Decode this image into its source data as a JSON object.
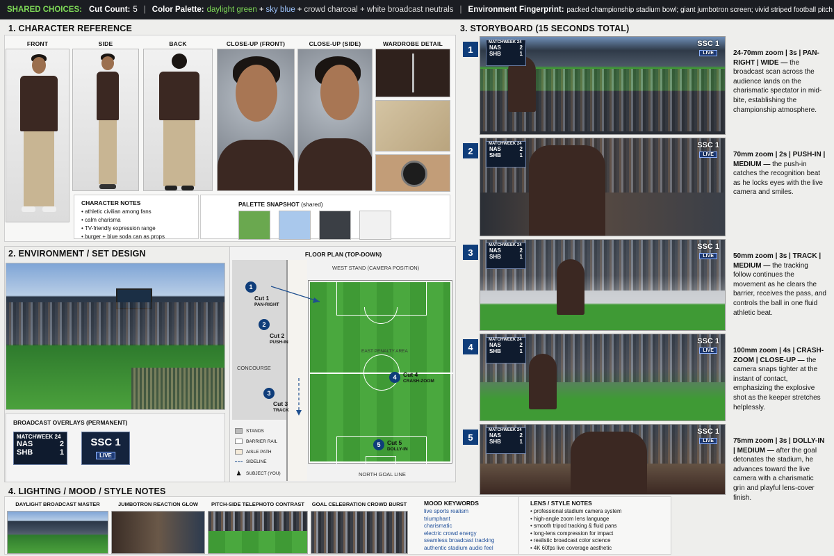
{
  "topbar": {
    "shared_label": "SHARED CHOICES:",
    "cut_label": "Cut Count:",
    "cut_value": "5",
    "palette_label": "Color Palette:",
    "palette_green": "daylight green",
    "plus1": "+",
    "palette_blue": "sky blue",
    "plus2": "+",
    "palette_rest": "crowd charcoal + white broadcast neutrals",
    "env_label": "Environment Fingerprint:",
    "env_value": "packed championship stadium bowl; giant jumbotron screen; vivid striped football pitch and white barrier rail.",
    "sep": "|"
  },
  "sections": {
    "character": "1. CHARACTER REFERENCE",
    "environment": "2. ENVIRONMENT / SET DESIGN",
    "storyboard": "3. STORYBOARD (15 SECONDS TOTAL)",
    "lighting": "4. LIGHTING / MOOD / STYLE NOTES"
  },
  "character": {
    "views": [
      "FRONT",
      "SIDE",
      "BACK",
      "CLOSE-UP (FRONT)",
      "CLOSE-UP (SIDE)",
      "WARDROBE DETAIL"
    ],
    "notes_title": "CHARACTER NOTES",
    "notes": [
      "athletic civilian among fans",
      "calm charisma",
      "TV-friendly expression range",
      "burger + blue soda can as props"
    ],
    "palette_title": "PALETTE SNAPSHOT",
    "palette_shared": "(shared)",
    "swatches": [
      "#6aa84f",
      "#a9c8ec",
      "#3b3f45",
      "#f1f1f1"
    ]
  },
  "environment": {
    "floor_plan_title": "FLOOR PLAN (TOP-DOWN)",
    "west_stand": "WEST STAND (CAMERA POSITION)",
    "concourse": "CONCOURSE",
    "east_penalty": "EAST PENALTY AREA",
    "north_goal": "NORTH GOAL LINE",
    "cuts": [
      {
        "num": "1",
        "name": "Cut 1",
        "move": "PAN-RIGHT"
      },
      {
        "num": "2",
        "name": "Cut 2",
        "move": "PUSH-IN"
      },
      {
        "num": "3",
        "name": "Cut 3",
        "move": "TRACK"
      },
      {
        "num": "4",
        "name": "Cut 4",
        "move": "CRASH-ZOOM"
      },
      {
        "num": "5",
        "name": "Cut 5",
        "move": "DOLLY-IN"
      }
    ],
    "legend": [
      "STANDS",
      "BARRIER RAIL",
      "AISLE PATH",
      "SIDELINE",
      "SUBJECT (YOU)"
    ],
    "overlays_title": "BROADCAST OVERLAYS (PERMANENT)",
    "scorebug": {
      "week": "MATCHWEEK 24",
      "team1": "NAS",
      "score1": "2",
      "team2": "SHB",
      "score2": "1"
    },
    "channel": {
      "name": "SSC 1",
      "live": "LIVE"
    }
  },
  "storyboard": [
    {
      "num": "1",
      "head": "24-70mm zoom | 3s | PAN-RIGHT | WIDE —",
      "body": "the broadcast scan across the audience lands on the charismatic spectator in mid-bite, establishing the championship atmosphere."
    },
    {
      "num": "2",
      "head": "70mm zoom | 2s | PUSH-IN | MEDIUM —",
      "body": "the push-in catches the recognition beat as he locks eyes with the live camera and smiles."
    },
    {
      "num": "3",
      "head": "50mm zoom | 3s | TRACK | MEDIUM —",
      "body": "the tracking follow continues the movement as he clears the barrier, receives the pass, and controls the ball in one fluid athletic beat."
    },
    {
      "num": "4",
      "head": "100mm zoom | 4s | CRASH-ZOOM | CLOSE-UP —",
      "body": "the camera snaps tighter at the instant of contact, emphasizing the explosive shot as the keeper stretches helplessly."
    },
    {
      "num": "5",
      "head": "75mm zoom | 3s | DOLLY-IN | MEDIUM —",
      "body": "after the goal detonates the stadium, he advances toward the live camera with a charismatic grin and playful lens-cover finish."
    }
  ],
  "lighting": {
    "frames": [
      "DAYLIGHT BROADCAST MASTER",
      "JUMBOTRON REACTION GLOW",
      "PITCH-SIDE TELEPHOTO CONTRAST",
      "GOAL CELEBRATION CROWD BURST"
    ],
    "mood_title": "MOOD KEYWORDS",
    "mood": [
      "live sports realism",
      "triumphant",
      "charismatic",
      "electric crowd energy",
      "seamless broadcast tracking",
      "authentic stadium audio feel"
    ],
    "lens_title": "LENS / STYLE NOTES",
    "lens": [
      "professional stadium camera system",
      "high-angle zoom lens language",
      "smooth tripod tracking & fluid pans",
      "long-lens compression for impact",
      "realistic broadcast color science",
      "4K 60fps live coverage aesthetic"
    ]
  }
}
